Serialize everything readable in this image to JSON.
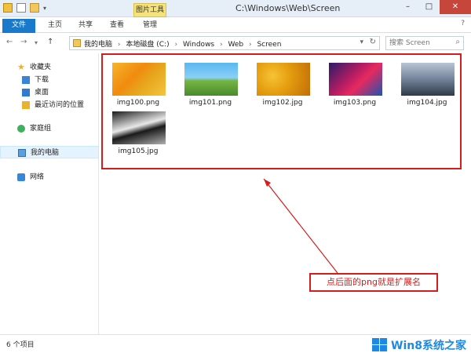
{
  "window": {
    "title": "C:\\Windows\\Web\\Screen",
    "context_tab": "图片工具",
    "controls": {
      "minimize": "–",
      "maximize": "□",
      "close": "✕"
    }
  },
  "quick_access": {
    "dropdown": "▾"
  },
  "ribbon": {
    "tabs": [
      "文件",
      "主页",
      "共享",
      "查看",
      "管理"
    ],
    "help_icon": "?"
  },
  "address": {
    "nav": {
      "back": "←",
      "forward": "→",
      "dropdown": "▾",
      "up": "↑"
    },
    "breadcrumbs": [
      "我的电脑",
      "本地磁盘 (C:)",
      "Windows",
      "Web",
      "Screen"
    ],
    "separator": "›",
    "dropdown": "▾",
    "refresh": "↻"
  },
  "search": {
    "placeholder": "搜索 Screen",
    "icon": "⌕"
  },
  "nav_pane": {
    "favorites": {
      "label": "收藏夹",
      "icon": "★",
      "children": [
        "下载",
        "桌面",
        "最近访问的位置"
      ]
    },
    "homegroup": {
      "label": "家庭组"
    },
    "this_pc": {
      "label": "我的电脑"
    },
    "network": {
      "label": "网络"
    }
  },
  "files": [
    {
      "name": "img100.png"
    },
    {
      "name": "img101.png"
    },
    {
      "name": "img102.jpg"
    },
    {
      "name": "img103.png"
    },
    {
      "name": "img104.jpg"
    },
    {
      "name": "img105.jpg"
    }
  ],
  "annotation": {
    "text": "点后面的png就是扩展名",
    "color": "#d71c1c"
  },
  "status": {
    "item_count": "6 个项目"
  },
  "watermark": {
    "text": "Win8系统之家",
    "color": "#1e88e5"
  }
}
